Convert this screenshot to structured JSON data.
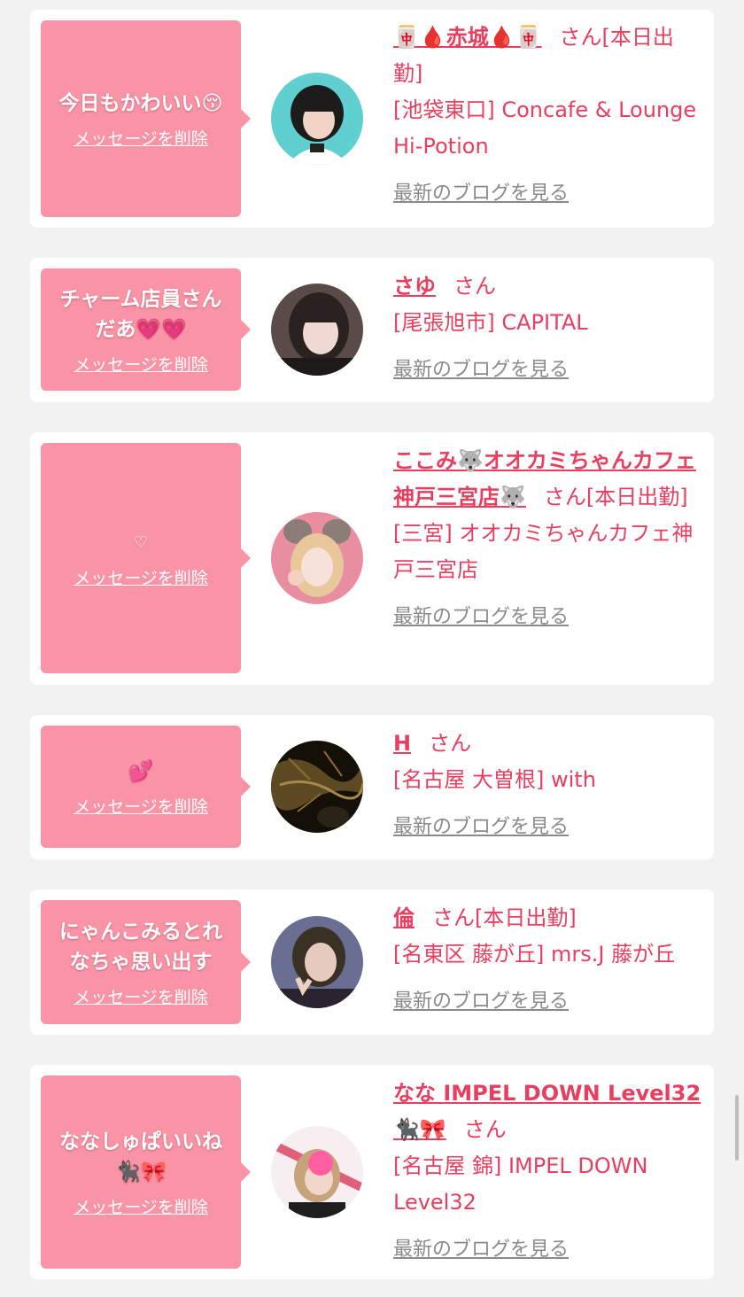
{
  "delete_label": "メッセージを削除",
  "blog_label": "最新のブログを見る",
  "san_label": "さん",
  "items": [
    {
      "message": "今日もかわいい😚",
      "name": "🀄🩸赤城🩸🀄",
      "shift": "[本日出勤]",
      "shop": "[池袋東口] Concafe & Lounge Hi-Potion"
    },
    {
      "message": "チャーム店員さんだあ💗💗",
      "name": "さゆ",
      "shift": "",
      "shop": "[尾張旭市] CAPITAL"
    },
    {
      "message": "♡",
      "name": "ここみ🐺オオカミちゃんカフェ神戸三宮店🐺",
      "shift": "[本日出勤]",
      "shop": "[三宮] オオカミちゃんカフェ神戸三宮店"
    },
    {
      "message": "💕",
      "name": "H",
      "shift": "",
      "shop": "[名古屋 大曽根] with"
    },
    {
      "message": "にゃんこみるとれなちゃ思い出す",
      "name": "倫",
      "shift": "[本日出勤]",
      "shop": "[名東区 藤が丘] mrs.J 藤が丘"
    },
    {
      "message": "ななしゅぱいいね🐈‍⬛🎀",
      "name": "なな IMPEL DOWN Level32 🐈‍⬛🎀",
      "shift": "",
      "shop": "[名古屋 錦] IMPEL DOWN Level32"
    }
  ]
}
